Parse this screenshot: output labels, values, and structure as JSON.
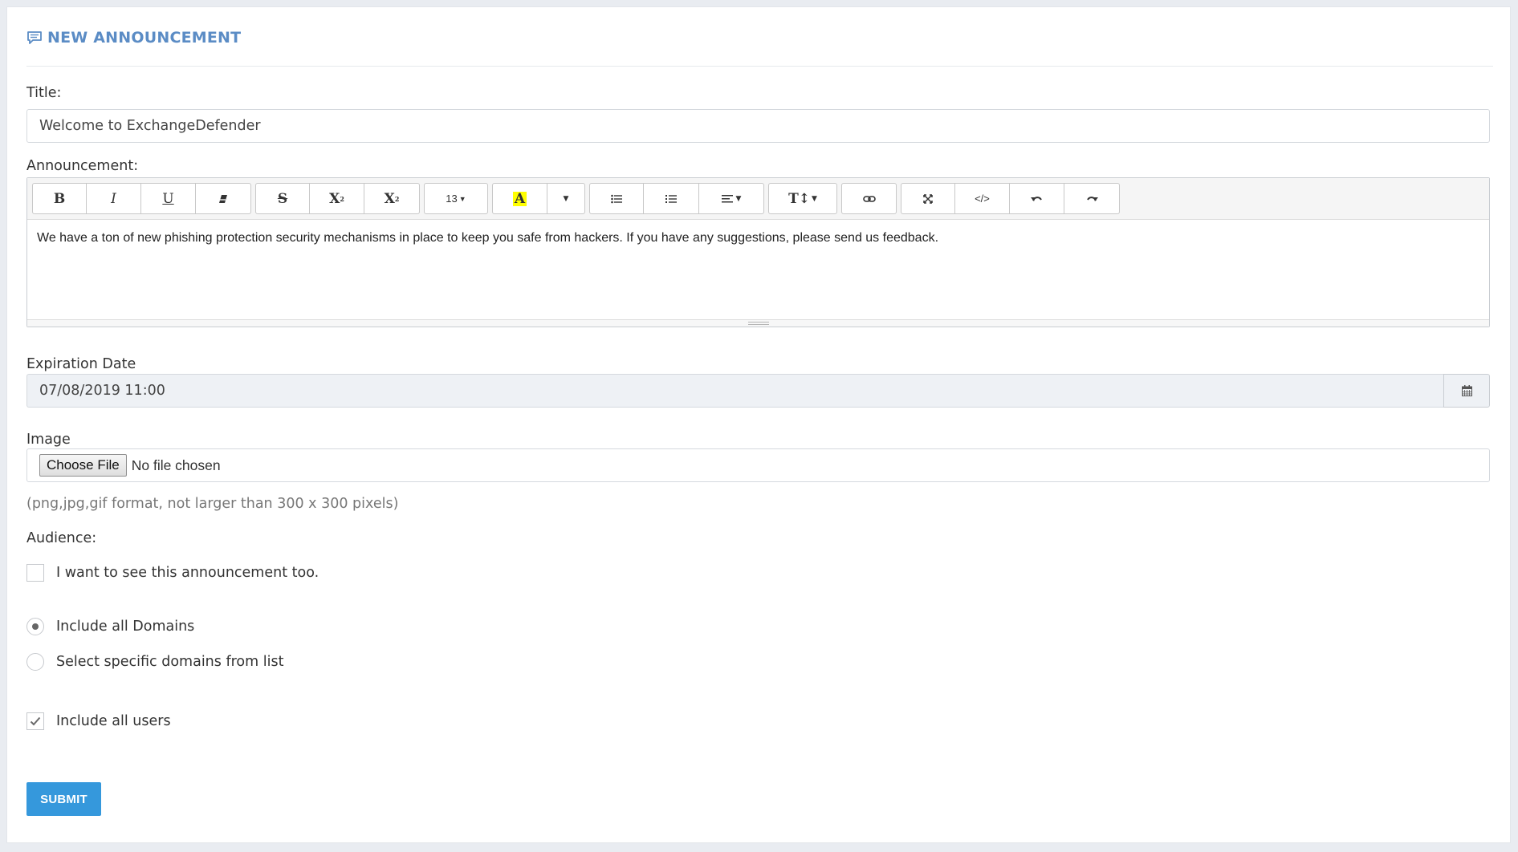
{
  "header": {
    "title": "NEW ANNOUNCEMENT",
    "icon": "comment-icon",
    "accent": "#5b8cc5"
  },
  "title_field": {
    "label": "Title:",
    "value": "Welcome to ExchangeDefender"
  },
  "announcement": {
    "label": "Announcement:",
    "toolbar": {
      "font_size": "13"
    },
    "body": "We have a ton of new phishing protection security mechanisms in place to keep you safe from hackers. If you have any suggestions, please send us feedback."
  },
  "expiration": {
    "label": "Expiration Date",
    "value": "07/08/2019 11:00",
    "icon": "calendar-icon"
  },
  "image": {
    "label": "Image",
    "button_label": "Choose File",
    "status": "No file chosen",
    "help": "(png,jpg,gif format, not larger than 300 x 300 pixels)"
  },
  "audience": {
    "label": "Audience:",
    "see_too": {
      "label": "I want to see this announcement too.",
      "checked": false
    },
    "all_domains": {
      "label": "Include all Domains",
      "selected": true
    },
    "specific_domains": {
      "label": "Select specific domains from list",
      "selected": false
    },
    "all_users": {
      "label": "Include all users",
      "checked": true
    }
  },
  "submit": {
    "label": "SUBMIT",
    "color": "#3598dc"
  }
}
